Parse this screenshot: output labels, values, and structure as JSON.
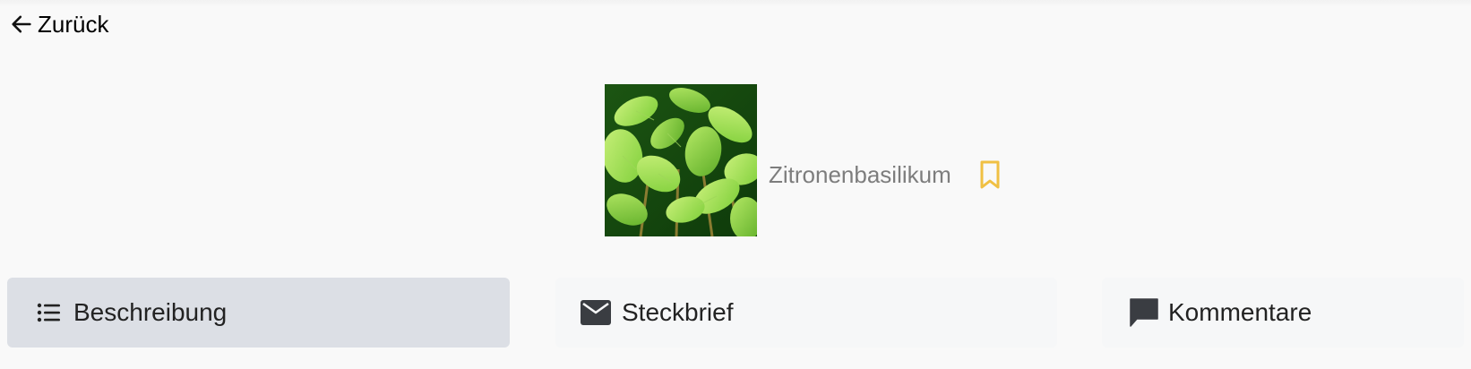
{
  "nav": {
    "back_label": "Zurück",
    "back_icon": "arrow-left-icon"
  },
  "plant": {
    "name": "Zitronenbasilikum",
    "image_alt": "Zitronenbasilikum",
    "bookmark_icon": "bookmark-icon",
    "bookmark_color": "#f0c043"
  },
  "tabs": [
    {
      "label": "Beschreibung",
      "icon": "list-icon",
      "active": true
    },
    {
      "label": "Steckbrief",
      "icon": "mail-icon",
      "active": false
    },
    {
      "label": "Kommentare",
      "icon": "comment-icon",
      "active": false
    }
  ],
  "colors": {
    "active_tab_bg": "#dcdfe5",
    "inactive_tab_bg": "#f6f7f8",
    "icon_dark": "#3a3d42",
    "name_text": "#7d7d7d"
  }
}
